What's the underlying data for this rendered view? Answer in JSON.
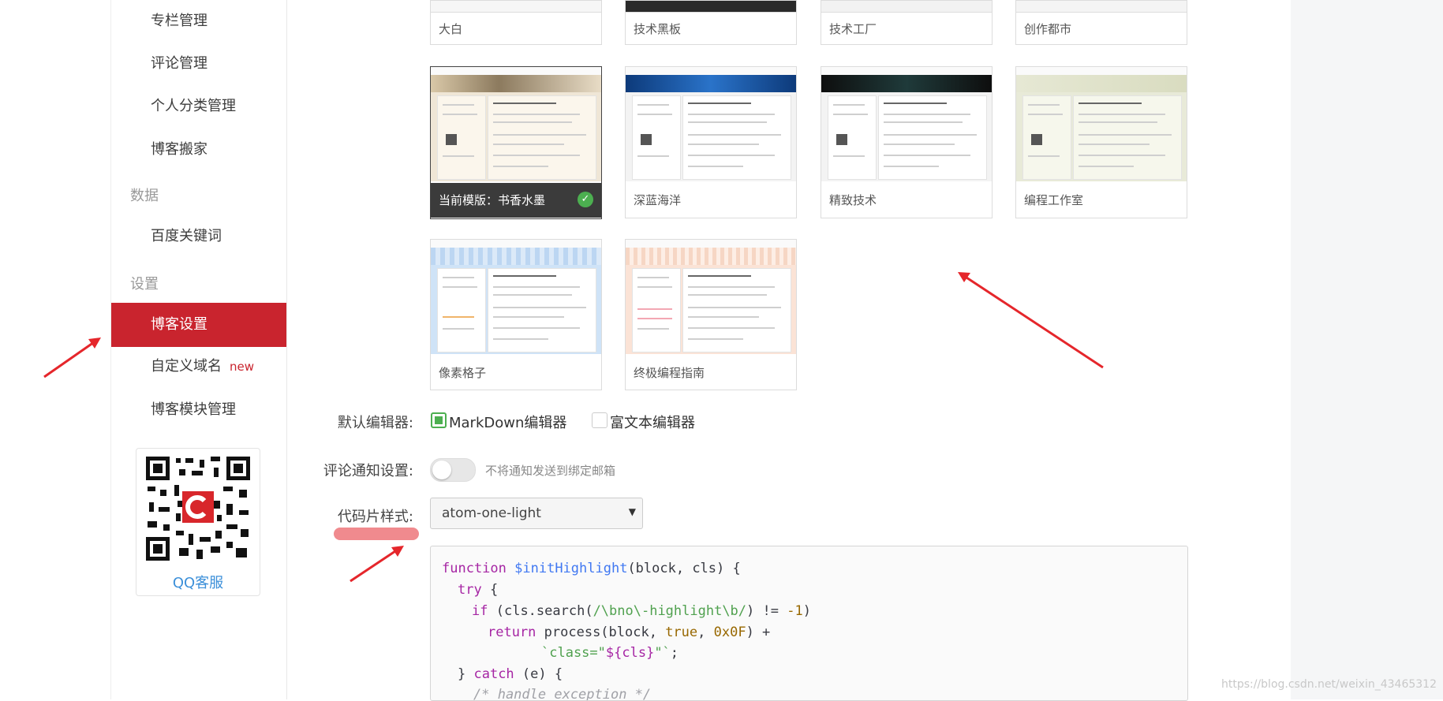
{
  "sidebar": {
    "items": [
      {
        "label": "专栏管理"
      },
      {
        "label": "评论管理"
      },
      {
        "label": "个人分类管理"
      },
      {
        "label": "博客搬家"
      },
      {
        "label": "百度关键词"
      },
      {
        "label": "博客设置"
      },
      {
        "label": "自定义域名",
        "badge": "new"
      },
      {
        "label": "博客模块管理"
      }
    ],
    "groups": {
      "data": "数据",
      "settings": "设置"
    },
    "qr_label": "QQ客服"
  },
  "templates": {
    "row1": [
      "大白",
      "技术黑板",
      "技术工厂",
      "创作都市"
    ],
    "row2": [
      "当前模版：书香水墨",
      "深蓝海洋",
      "精致技术",
      "编程工作室"
    ],
    "row3": [
      "像素格子",
      "终极编程指南"
    ]
  },
  "form": {
    "editor_label": "默认编辑器:",
    "editor_options": [
      "MarkDown编辑器",
      "富文本编辑器"
    ],
    "comment_label": "评论通知设置:",
    "comment_hint": "不将通知发送到绑定邮箱",
    "code_label": "代码片样式:",
    "code_style": "atom-one-light"
  },
  "code": {
    "l1a": "function",
    "l1b": "$initHighlight",
    "l1c": "(block, cls) {",
    "l2a": "try",
    "l2b": "{",
    "l3a": "if",
    "l3b": "(cls.search(",
    "l3c": "/\\bno\\-highlight\\b/",
    "l3d": ") != ",
    "l3e": "-1",
    "l3f": ")",
    "l4a": "return",
    "l4b": " process(block, ",
    "l4c": "true",
    "l4d": ", ",
    "l4e": "0x0F",
    "l4f": ") +",
    "l5a": "`class=\"",
    "l5b": "${cls}",
    "l5c": "\"`",
    "l5d": ";",
    "l6a": "} ",
    "l6b": "catch",
    "l6c": " (e) {",
    "l7": "/* handle exception */"
  },
  "watermark": "https://blog.csdn.net/weixin_43465312",
  "colors": {
    "accent": "#c9242e",
    "check": "#4caf50",
    "link": "#3b8fd9",
    "arrow": "#e5262b"
  }
}
